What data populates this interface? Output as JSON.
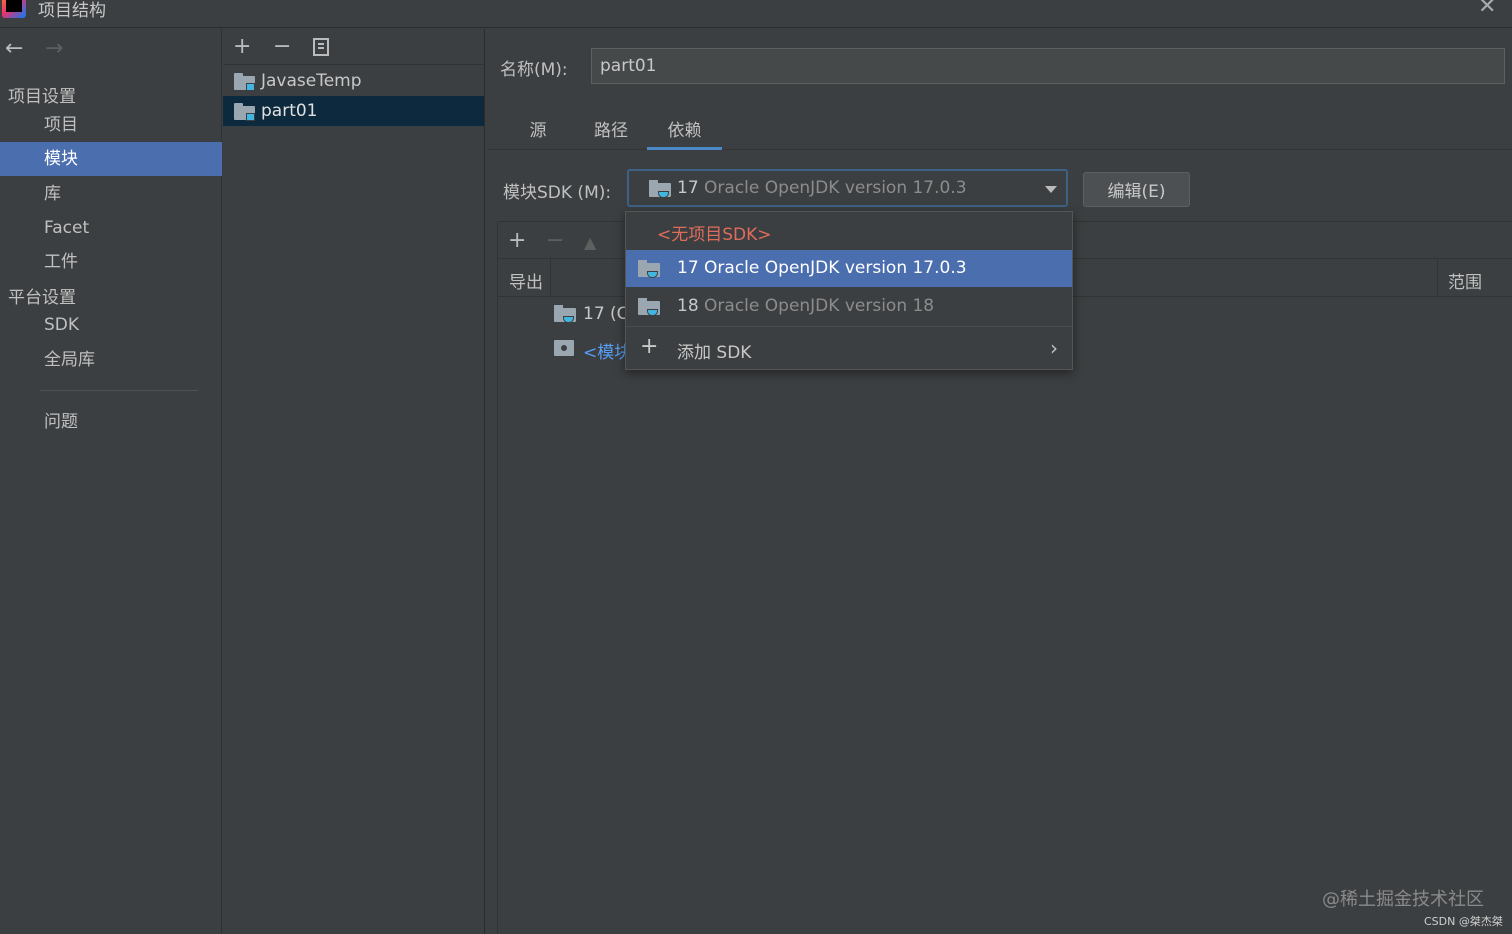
{
  "window": {
    "title": "项目结构"
  },
  "sidebar": {
    "project_settings_header": "项目设置",
    "platform_settings_header": "平台设置",
    "project_items": [
      {
        "label": "项目"
      },
      {
        "label": "模块",
        "selected": true
      },
      {
        "label": "库"
      },
      {
        "label": "Facet"
      },
      {
        "label": "工件"
      }
    ],
    "platform_items": [
      {
        "label": "SDK"
      },
      {
        "label": "全局库"
      }
    ],
    "problems": "问题"
  },
  "modules_panel": {
    "toolbar": {
      "add": "+",
      "remove": "−"
    },
    "modules": [
      {
        "name": "JavaseTemp"
      },
      {
        "name": "part01",
        "selected": true
      }
    ]
  },
  "detail": {
    "name_label": "名称(M):",
    "name_value": "part01",
    "tabs": [
      {
        "label": "源"
      },
      {
        "label": "路径"
      },
      {
        "label": "依赖",
        "active": true
      }
    ],
    "sdk_label": "模块SDK (M):",
    "sdk_selected_version": "17",
    "sdk_selected_desc": "Oracle OpenJDK version 17.0.3",
    "edit_button": "编辑(E)",
    "deps_toolbar": {
      "add": "+",
      "remove": "−",
      "up": "▲"
    },
    "deps_columns": {
      "export": "导出",
      "scope": "范围"
    },
    "dep_rows": [
      {
        "text": "17 (C"
      },
      {
        "text": "<模块"
      }
    ]
  },
  "sdk_popup": {
    "no_sdk": "<无项目SDK>",
    "options": [
      {
        "version": "17",
        "desc": "Oracle OpenJDK version 17.0.3",
        "highlighted": true
      },
      {
        "version": "18",
        "desc": "Oracle OpenJDK version 18"
      }
    ],
    "add_sdk": "添加 SDK",
    "add_sdk_icon": "+",
    "submenu_icon": "›"
  },
  "watermarks": {
    "juejin": "@稀土掘金技术社区",
    "csdn": "CSDN @桀杰桀"
  },
  "colors": {
    "background": "#3c3f41",
    "selection": "#4b6eaf",
    "module_selection": "#0d293e",
    "tab_underline": "#4a88c7",
    "no_sdk_text": "#e06c5b",
    "link_blue": "#589df6"
  }
}
